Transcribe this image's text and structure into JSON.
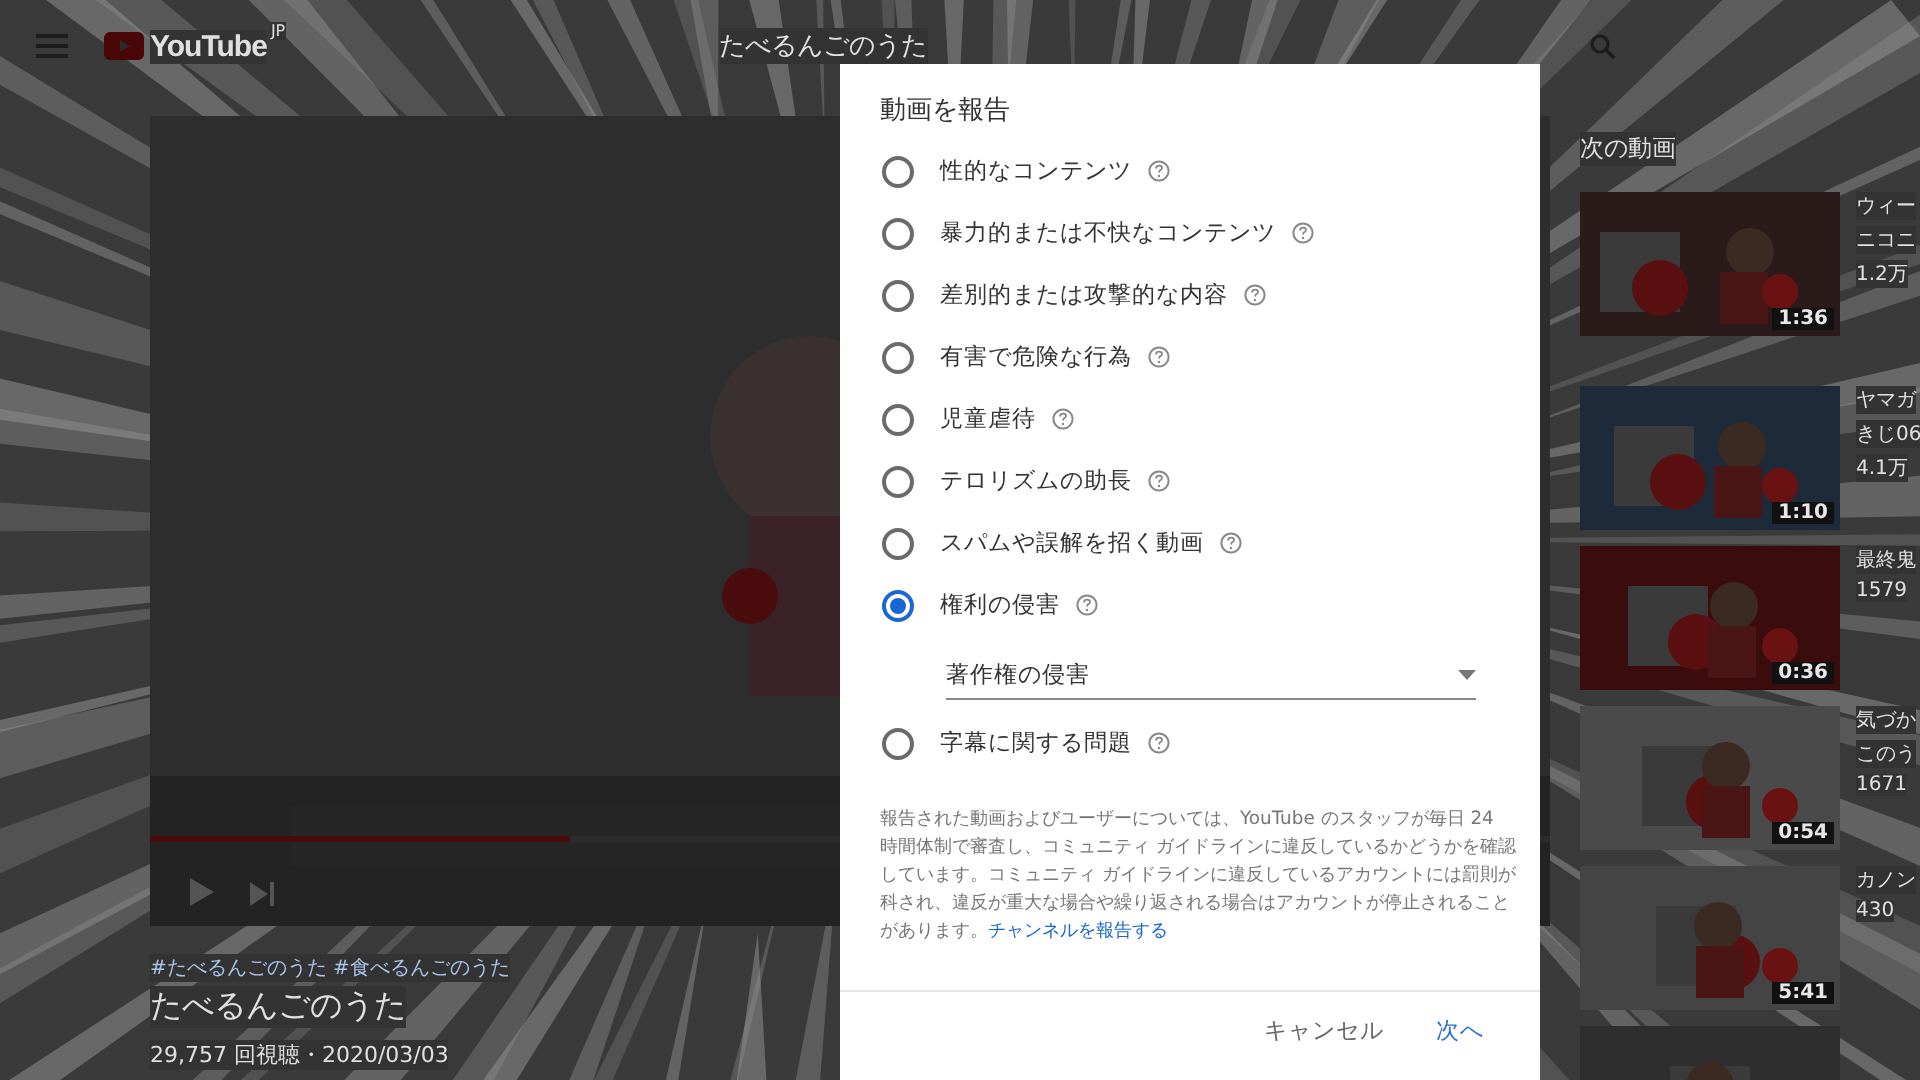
{
  "topbar": {
    "logo": "YouTube",
    "region": "JP",
    "search_text": "たべるんごのうた"
  },
  "video": {
    "hashtags": "#たべるんごのうた #食べるんごのうた",
    "title": "たべるんごのうた",
    "views": "29,757 回視聴・2020/03/03",
    "progress": {
      "level": 0.3
    }
  },
  "up_next": {
    "heading": "次の動画",
    "items": [
      {
        "duration": "1:36",
        "lines": [
          "ウィー",
          "ニコニ",
          "1.2万"
        ]
      },
      {
        "duration": "1:10",
        "lines": [
          "ヤマガ",
          "きじ06",
          "4.1万"
        ]
      },
      {
        "duration": "0:36",
        "lines": [
          "最終鬼",
          "1579"
        ]
      },
      {
        "duration": "0:54",
        "lines": [
          "気づか",
          "このう",
          "1671"
        ]
      },
      {
        "duration": "5:41",
        "lines": [
          "カノン",
          "430"
        ]
      },
      {
        "kind": "picture"
      }
    ]
  },
  "dialog": {
    "title": "動画を報告",
    "options": [
      {
        "label": "性的なコンテンツ",
        "selected": false
      },
      {
        "label": "暴力的または不快なコンテンツ",
        "selected": false
      },
      {
        "label": "差別的または攻撃的な内容",
        "selected": false
      },
      {
        "label": "有害で危険な行為",
        "selected": false
      },
      {
        "label": "児童虐待",
        "selected": false
      },
      {
        "label": "テロリズムの助長",
        "selected": false
      },
      {
        "label": "スパムや誤解を招く動画",
        "selected": false
      },
      {
        "label": "権利の侵害",
        "selected": true,
        "dropdown": {
          "value": "著作権の侵害"
        }
      },
      {
        "label": "字幕に関する問題",
        "selected": false
      }
    ],
    "notice": "報告された動画およびユーザーについては、YouTube のスタッフが毎日 24 時間体制で審査し、コミュニティ ガイドラインに違反しているかどうかを確認しています。コミュニティ ガイドラインに違反しているアカウントには罰則が科され、違反が重大な場合や繰り返される場合はアカウントが停止されることがあります。",
    "notice_link": "チャンネルを報告する",
    "buttons": [
      {
        "label": "キャンセル",
        "kind": "secondary"
      },
      {
        "label": "次へ",
        "kind": "primary"
      }
    ]
  }
}
